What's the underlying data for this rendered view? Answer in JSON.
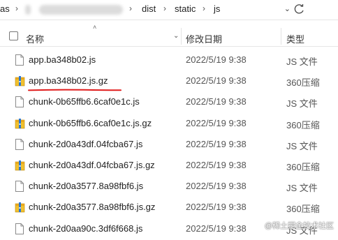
{
  "address": {
    "prefix": "as",
    "path": [
      "dist",
      "static",
      "js"
    ]
  },
  "header": {
    "name": "名称",
    "date": "修改日期",
    "type": "类型"
  },
  "files": [
    {
      "name": "app.ba348b02.js",
      "date": "2022/5/19 9:38",
      "type": "JS 文件",
      "kind": "js"
    },
    {
      "name": "app.ba348b02.js.gz",
      "date": "2022/5/19 9:38",
      "type": "360压缩",
      "kind": "gz"
    },
    {
      "name": "chunk-0b65ffb6.6caf0e1c.js",
      "date": "2022/5/19 9:38",
      "type": "JS 文件",
      "kind": "js"
    },
    {
      "name": "chunk-0b65ffb6.6caf0e1c.js.gz",
      "date": "2022/5/19 9:38",
      "type": "360压缩",
      "kind": "gz"
    },
    {
      "name": "chunk-2d0a43df.04fcba67.js",
      "date": "2022/5/19 9:38",
      "type": "JS 文件",
      "kind": "js"
    },
    {
      "name": "chunk-2d0a43df.04fcba67.js.gz",
      "date": "2022/5/19 9:38",
      "type": "360压缩",
      "kind": "gz"
    },
    {
      "name": "chunk-2d0a3577.8a98fbf6.js",
      "date": "2022/5/19 9:38",
      "type": "JS 文件",
      "kind": "js"
    },
    {
      "name": "chunk-2d0a3577.8a98fbf6.js.gz",
      "date": "2022/5/19 9:38",
      "type": "360压缩",
      "kind": "gz"
    },
    {
      "name": "chunk-2d0aa90c.3df6f668.js",
      "date": "2022/5/19 9:38",
      "type": "JS 文件",
      "kind": "js"
    }
  ],
  "watermark": "@稀土掘金技术社区",
  "colors": {
    "annotation_red": "#e01b1b",
    "zip_yellow": "#f2c12e",
    "zip_blue": "#2b78d4"
  }
}
